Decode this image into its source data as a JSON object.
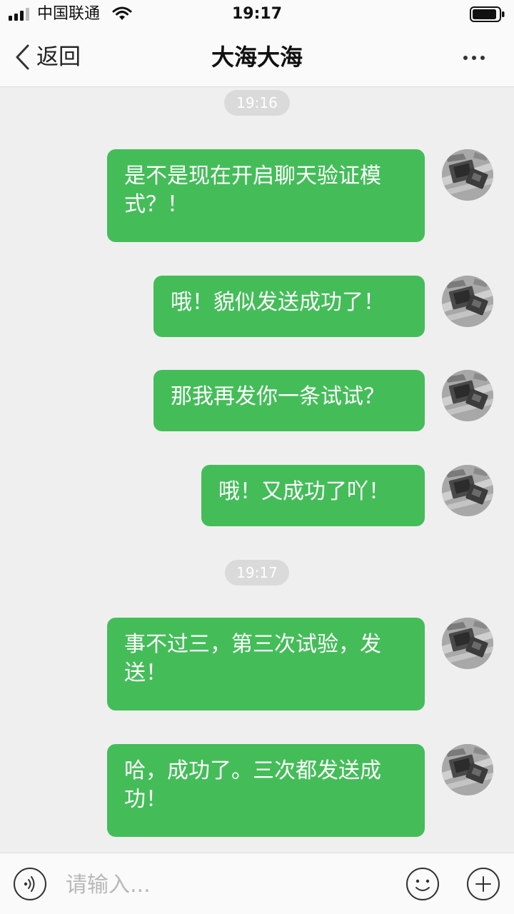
{
  "status_bar": {
    "carrier": "中国联通",
    "time": "19:17",
    "icons": [
      "signal-icon",
      "wifi-icon",
      "battery-icon"
    ]
  },
  "nav": {
    "back_label": "返回",
    "title": "大海大海",
    "icons": [
      "chevron-left-icon",
      "more-icon"
    ]
  },
  "chat": {
    "bubble_color": "#44bd59",
    "background_color": "#efefef",
    "timestamps": [
      "19:16",
      "19:17"
    ],
    "messages": [
      {
        "text": "是不是现在开启聊天验证模式？！"
      },
      {
        "text": "哦！貌似发送成功了！"
      },
      {
        "text": "那我再发你一条试试？"
      },
      {
        "text": "哦！又成功了吖！"
      },
      {
        "text": "事不过三，第三次试验，发送！"
      },
      {
        "text": "哈，成功了。三次都发送成功！"
      }
    ]
  },
  "input_bar": {
    "placeholder": "请输入...",
    "value": "",
    "icons": [
      "voice-icon",
      "emoji-icon",
      "plus-icon"
    ]
  }
}
